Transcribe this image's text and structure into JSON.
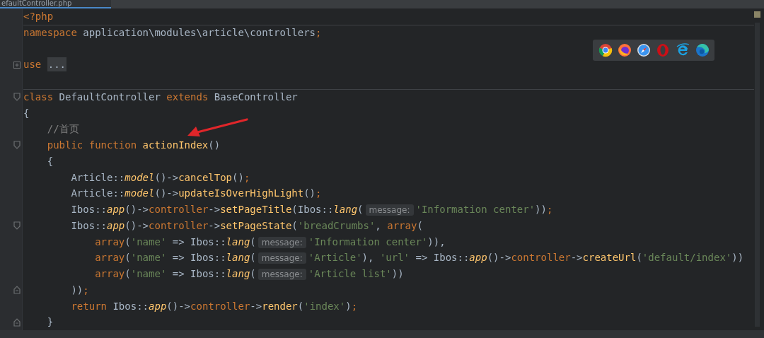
{
  "tab": {
    "label": "efaultController.php",
    "selected": true
  },
  "lines": [
    {
      "tokens": [
        {
          "kind": "kw",
          "text": "<?php"
        }
      ]
    },
    {
      "separator_above": true,
      "tokens": [
        {
          "kind": "kw",
          "text": "namespace"
        },
        {
          "kind": "plain",
          "text": " application\\modules\\article\\controllers"
        },
        {
          "kind": "kw",
          "text": ";"
        }
      ]
    },
    {
      "kind": "blank"
    },
    {
      "expanded": false,
      "tokens": [
        {
          "kind": "kw",
          "text": "use "
        },
        {
          "kind": "folded",
          "text": "..."
        }
      ]
    },
    {
      "kind": "blank"
    },
    {
      "separator_above": true,
      "expanded": true,
      "tokens": [
        {
          "kind": "kw",
          "text": "class"
        },
        {
          "kind": "plain",
          "text": " DefaultController "
        },
        {
          "kind": "kw",
          "text": "extends"
        },
        {
          "kind": "plain",
          "text": " BaseController"
        }
      ]
    },
    {
      "tokens": [
        {
          "kind": "plain",
          "text": "{"
        }
      ]
    },
    {
      "tokens": [
        {
          "kind": "comment",
          "text": "    //首页"
        }
      ]
    },
    {
      "expanded": true,
      "tokens": [
        {
          "kind": "kw",
          "text": "    public function "
        },
        {
          "kind": "fn",
          "text": "actionIndex"
        },
        {
          "kind": "plain",
          "text": "()"
        }
      ]
    },
    {
      "tokens": [
        {
          "kind": "plain",
          "text": "    {"
        }
      ]
    },
    {
      "tokens": [
        {
          "kind": "plain",
          "text": "        Article::"
        },
        {
          "kind": "static",
          "text": "model"
        },
        {
          "kind": "plain",
          "text": "()->"
        },
        {
          "kind": "fn",
          "text": "cancelTop"
        },
        {
          "kind": "plain",
          "text": "()"
        },
        {
          "kind": "kw",
          "text": ";"
        }
      ]
    },
    {
      "tokens": [
        {
          "kind": "plain",
          "text": "        Article::"
        },
        {
          "kind": "static",
          "text": "model"
        },
        {
          "kind": "plain",
          "text": "()->"
        },
        {
          "kind": "fn",
          "text": "updateIsOverHighLight"
        },
        {
          "kind": "plain",
          "text": "()"
        },
        {
          "kind": "kw",
          "text": ";"
        }
      ]
    },
    {
      "tokens": [
        {
          "kind": "plain",
          "text": "        Ibos::"
        },
        {
          "kind": "static",
          "text": "app"
        },
        {
          "kind": "plain",
          "text": "()->"
        },
        {
          "kind": "kw",
          "text": "controller"
        },
        {
          "kind": "plain",
          "text": "->"
        },
        {
          "kind": "fn",
          "text": "setPageTitle"
        },
        {
          "kind": "plain",
          "text": "(Ibos::"
        },
        {
          "kind": "static",
          "text": "lang"
        },
        {
          "kind": "plain",
          "text": "("
        },
        {
          "kind": "hint",
          "text": "message:"
        },
        {
          "kind": "str",
          "text": "'Information center'"
        },
        {
          "kind": "plain",
          "text": "))"
        },
        {
          "kind": "kw",
          "text": ";"
        }
      ]
    },
    {
      "expanded": true,
      "tokens": [
        {
          "kind": "plain",
          "text": "        Ibos::"
        },
        {
          "kind": "static",
          "text": "app"
        },
        {
          "kind": "plain",
          "text": "()->"
        },
        {
          "kind": "kw",
          "text": "controller"
        },
        {
          "kind": "plain",
          "text": "->"
        },
        {
          "kind": "fn",
          "text": "setPageState"
        },
        {
          "kind": "plain",
          "text": "("
        },
        {
          "kind": "str",
          "text": "'breadCrumbs'"
        },
        {
          "kind": "plain",
          "text": ", "
        },
        {
          "kind": "kw",
          "text": "array"
        },
        {
          "kind": "plain",
          "text": "("
        }
      ]
    },
    {
      "tokens": [
        {
          "kind": "kw",
          "text": "            array"
        },
        {
          "kind": "plain",
          "text": "("
        },
        {
          "kind": "str",
          "text": "'name'"
        },
        {
          "kind": "plain",
          "text": " => Ibos::"
        },
        {
          "kind": "static",
          "text": "lang"
        },
        {
          "kind": "plain",
          "text": "("
        },
        {
          "kind": "hint",
          "text": "message:"
        },
        {
          "kind": "str",
          "text": "'Information center'"
        },
        {
          "kind": "plain",
          "text": ")),"
        }
      ]
    },
    {
      "tokens": [
        {
          "kind": "kw",
          "text": "            array"
        },
        {
          "kind": "plain",
          "text": "("
        },
        {
          "kind": "str",
          "text": "'name'"
        },
        {
          "kind": "plain",
          "text": " => Ibos::"
        },
        {
          "kind": "static",
          "text": "lang"
        },
        {
          "kind": "plain",
          "text": "("
        },
        {
          "kind": "hint",
          "text": "message:"
        },
        {
          "kind": "str",
          "text": "'Article'"
        },
        {
          "kind": "plain",
          "text": "), "
        },
        {
          "kind": "str",
          "text": "'url'"
        },
        {
          "kind": "plain",
          "text": " => Ibos::"
        },
        {
          "kind": "static",
          "text": "app"
        },
        {
          "kind": "plain",
          "text": "()->"
        },
        {
          "kind": "kw",
          "text": "controller"
        },
        {
          "kind": "plain",
          "text": "->"
        },
        {
          "kind": "fn",
          "text": "createUrl"
        },
        {
          "kind": "plain",
          "text": "("
        },
        {
          "kind": "str",
          "text": "'default/index'"
        },
        {
          "kind": "plain",
          "text": "))"
        }
      ]
    },
    {
      "tokens": [
        {
          "kind": "kw",
          "text": "            array"
        },
        {
          "kind": "plain",
          "text": "("
        },
        {
          "kind": "str",
          "text": "'name'"
        },
        {
          "kind": "plain",
          "text": " => Ibos::"
        },
        {
          "kind": "static",
          "text": "lang"
        },
        {
          "kind": "plain",
          "text": "("
        },
        {
          "kind": "hint",
          "text": "message:"
        },
        {
          "kind": "str",
          "text": "'Article list'"
        },
        {
          "kind": "plain",
          "text": "))"
        }
      ]
    },
    {
      "fold_end": true,
      "tokens": [
        {
          "kind": "plain",
          "text": "        ))"
        },
        {
          "kind": "kw",
          "text": ";"
        }
      ]
    },
    {
      "tokens": [
        {
          "kind": "kw",
          "text": "        return"
        },
        {
          "kind": "plain",
          "text": " Ibos::"
        },
        {
          "kind": "static",
          "text": "app"
        },
        {
          "kind": "plain",
          "text": "()->"
        },
        {
          "kind": "kw",
          "text": "controller"
        },
        {
          "kind": "plain",
          "text": "->"
        },
        {
          "kind": "fn",
          "text": "render"
        },
        {
          "kind": "plain",
          "text": "("
        },
        {
          "kind": "str",
          "text": "'index'"
        },
        {
          "kind": "plain",
          "text": ")"
        },
        {
          "kind": "kw",
          "text": ";"
        }
      ]
    },
    {
      "fold_end": true,
      "tokens": [
        {
          "kind": "plain",
          "text": "    }"
        }
      ]
    }
  ]
}
